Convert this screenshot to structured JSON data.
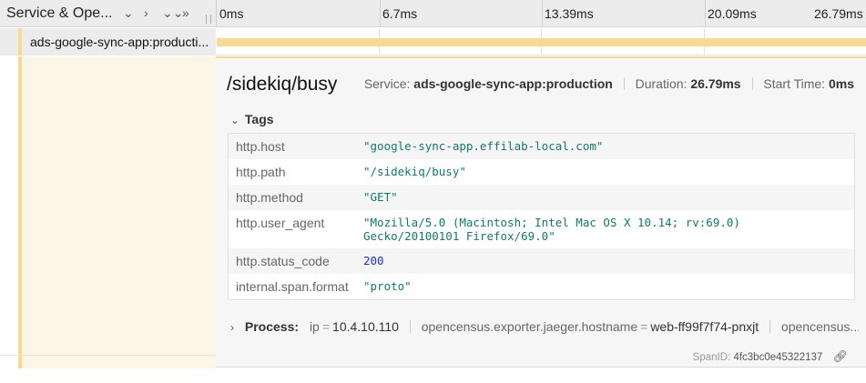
{
  "header": {
    "title": "Service & Ope...",
    "controls": [
      {
        "name": "collapse-one-icon",
        "glyph": "⌄"
      },
      {
        "name": "expand-one-icon",
        "glyph": "›"
      },
      {
        "name": "collapse-all-icon",
        "glyph": "⌄⌄"
      },
      {
        "name": "expand-all-icon",
        "glyph": "»"
      }
    ],
    "ticks": [
      "0ms",
      "6.7ms",
      "13.39ms",
      "20.09ms",
      "26.79ms"
    ]
  },
  "span_row": {
    "name": "ads-google-sync-app:producti...",
    "bar_color": "#f7d993",
    "bar_fraction": 1.0
  },
  "detail": {
    "operation": "/sidekiq/busy",
    "service_label": "Service:",
    "service_value": "ads-google-sync-app:production",
    "duration_label": "Duration:",
    "duration_value": "26.79ms",
    "start_label": "Start Time:",
    "start_value": "0ms",
    "tags_title": "Tags",
    "tags": [
      {
        "key": "http.host",
        "value": "\"google-sync-app.effilab-local.com\"",
        "kind": "string"
      },
      {
        "key": "http.path",
        "value": "\"/sidekiq/busy\"",
        "kind": "string"
      },
      {
        "key": "http.method",
        "value": "\"GET\"",
        "kind": "string"
      },
      {
        "key": "http.user_agent",
        "value": "\"Mozilla/5.0 (Macintosh; Intel Mac OS X 10.14; rv:69.0)\nGecko/20100101 Firefox/69.0\"",
        "kind": "string"
      },
      {
        "key": "http.status_code",
        "value": "200",
        "kind": "number"
      },
      {
        "key": "internal.span.format",
        "value": "\"proto\"",
        "kind": "string"
      }
    ],
    "process_title": "Process:",
    "process": [
      {
        "key": "ip",
        "value": "10.4.10.110"
      },
      {
        "key": "opencensus.exporter.jaeger.hostname",
        "value": "web-ff99f7f74-pnxjt"
      },
      {
        "key": "opencensus...",
        "value": ""
      }
    ],
    "span_id_label": "SpanID:",
    "span_id_value": "4fc3bc0e45322137",
    "link_icon": "link-icon"
  },
  "colors": {
    "accent": "#f7d993",
    "string_value": "#0e7a6e",
    "number_value": "#1a35c7"
  }
}
